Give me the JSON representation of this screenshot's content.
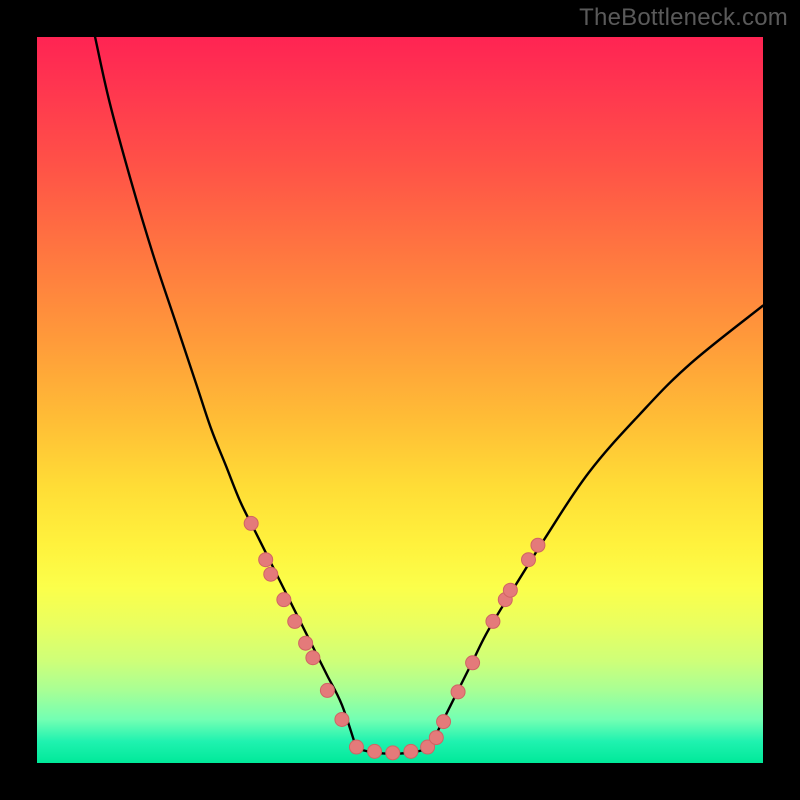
{
  "watermark": "TheBottleneck.com",
  "colors": {
    "curve": "#000000",
    "marker_fill": "#e47a7a",
    "marker_stroke": "#d06464",
    "frame": "#000000"
  },
  "chart_data": {
    "type": "line",
    "title": "",
    "xlabel": "",
    "ylabel": "",
    "xlim": [
      0,
      100
    ],
    "ylim": [
      0,
      100
    ],
    "grid": false,
    "series": [
      {
        "name": "left-curve",
        "x": [
          8,
          10,
          13,
          16,
          19,
          22,
          24,
          26,
          28,
          30,
          32,
          34,
          35,
          36,
          37,
          38,
          39,
          40,
          42,
          44
        ],
        "y": [
          100,
          91,
          80,
          70,
          61,
          52,
          46,
          41,
          36,
          32,
          28,
          24,
          22,
          20,
          18,
          16,
          14,
          12,
          8,
          2
        ]
      },
      {
        "name": "flat-bottom",
        "x": [
          44,
          46,
          48,
          50,
          52,
          54
        ],
        "y": [
          2,
          1.5,
          1.3,
          1.3,
          1.5,
          2
        ]
      },
      {
        "name": "right-curve",
        "x": [
          54,
          56,
          58,
          60,
          62,
          65,
          70,
          76,
          83,
          90,
          100
        ],
        "y": [
          2,
          6,
          10,
          14,
          18,
          23,
          31,
          40,
          48,
          55,
          63
        ]
      }
    ],
    "markers": {
      "name": "sample-points",
      "radius_px": 7,
      "points": [
        {
          "x": 29.5,
          "y": 33
        },
        {
          "x": 31.5,
          "y": 28
        },
        {
          "x": 32.2,
          "y": 26
        },
        {
          "x": 34.0,
          "y": 22.5
        },
        {
          "x": 35.5,
          "y": 19.5
        },
        {
          "x": 37.0,
          "y": 16.5
        },
        {
          "x": 38.0,
          "y": 14.5
        },
        {
          "x": 40.0,
          "y": 10
        },
        {
          "x": 42.0,
          "y": 6
        },
        {
          "x": 44.0,
          "y": 2.2
        },
        {
          "x": 46.5,
          "y": 1.6
        },
        {
          "x": 49.0,
          "y": 1.4
        },
        {
          "x": 51.5,
          "y": 1.6
        },
        {
          "x": 53.8,
          "y": 2.2
        },
        {
          "x": 55.0,
          "y": 3.5
        },
        {
          "x": 56.0,
          "y": 5.7
        },
        {
          "x": 58.0,
          "y": 9.8
        },
        {
          "x": 60.0,
          "y": 13.8
        },
        {
          "x": 62.8,
          "y": 19.5
        },
        {
          "x": 64.5,
          "y": 22.5
        },
        {
          "x": 65.2,
          "y": 23.8
        },
        {
          "x": 67.7,
          "y": 28
        },
        {
          "x": 69.0,
          "y": 30
        }
      ]
    }
  }
}
